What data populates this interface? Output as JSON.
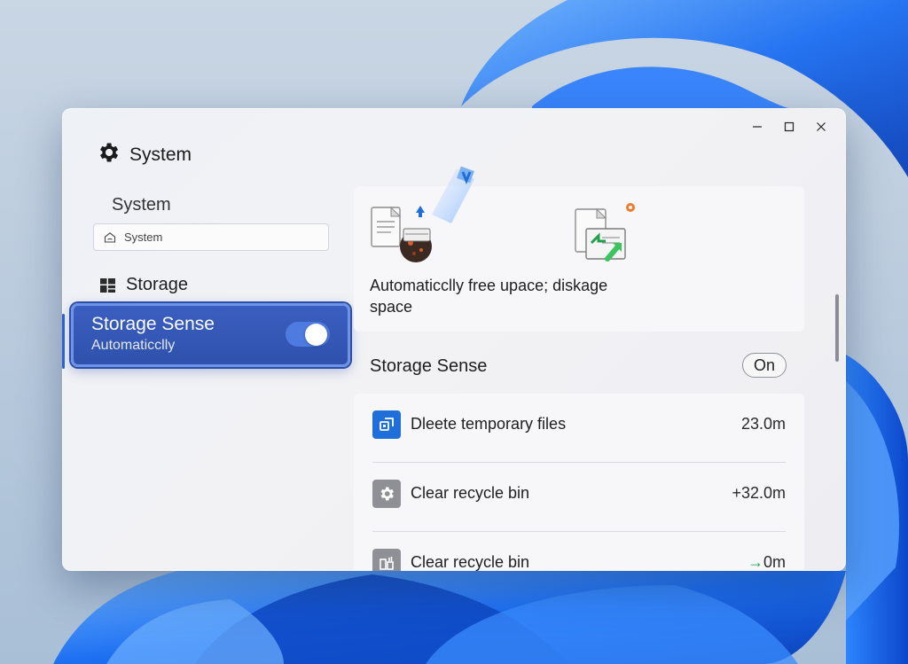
{
  "window": {
    "title": "System",
    "controls": [
      "minimize",
      "maximize",
      "close"
    ]
  },
  "sidebar": {
    "heading": "System",
    "search": {
      "value": "System",
      "icon": "home-icon"
    },
    "nav_storage": {
      "label": "Storage",
      "icon": "storage-grid-icon"
    },
    "active_card": {
      "title": "Storage Sense",
      "subtitle": "Automaticclly",
      "toggle_state": "on"
    }
  },
  "hero": {
    "caption": "Automaticclly free upace; diskage space",
    "icons": [
      "temporary-files-illustration",
      "recycle-file-illustration"
    ]
  },
  "storage_sense": {
    "title": "Storage Sense",
    "status_label": "On",
    "rows": [
      {
        "label": "Dleete temporary files",
        "value": "23.0m",
        "icon": "temp-files-icon",
        "accent": "#1e6fd9"
      },
      {
        "label": "Clear recycle bin",
        "value": "+32.0m",
        "icon": "settings-cog-icon",
        "accent": "#8e9096"
      },
      {
        "label": "Clear recycle bin",
        "value": "0m",
        "value_prefix": "→",
        "icon": "recycle-bin-icon",
        "accent": "#8e9096"
      }
    ]
  },
  "colors": {
    "accent": "#2f51ad",
    "toggle_on": "#4d7be0",
    "positive_arrow": "#18a35a"
  }
}
